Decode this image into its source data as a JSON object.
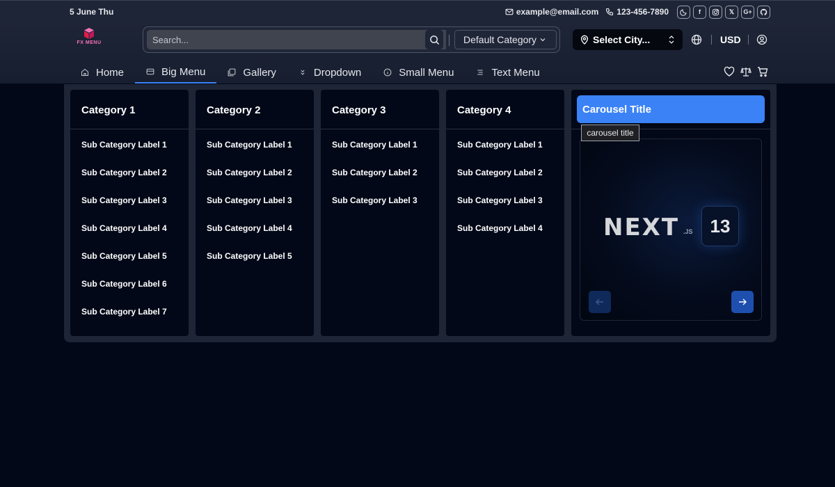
{
  "topbar": {
    "date": "5 June Thu",
    "email": "example@email.com",
    "phone": "123-456-7890",
    "social": [
      {
        "icon": "moon-icon",
        "label": ""
      },
      {
        "icon": "facebook-icon",
        "label": "f"
      },
      {
        "icon": "instagram-icon",
        "label": ""
      },
      {
        "icon": "x-icon",
        "label": "𝕏"
      },
      {
        "icon": "google-plus-icon",
        "label": "G+"
      },
      {
        "icon": "github-icon",
        "label": ""
      }
    ]
  },
  "header": {
    "logo_text": "FX MENU",
    "search_placeholder": "Search...",
    "category_select": "Default Category",
    "city_select": "Select City...",
    "currency": "USD"
  },
  "nav": {
    "items": [
      {
        "label": "Home",
        "icon": "home-icon"
      },
      {
        "label": "Big Menu",
        "icon": "menu-card-icon"
      },
      {
        "label": "Gallery",
        "icon": "gallery-icon"
      },
      {
        "label": "Dropdown",
        "icon": "chevrons-icon"
      },
      {
        "label": "Small Menu",
        "icon": "info-icon"
      },
      {
        "label": "Text Menu",
        "icon": "text-lines-icon"
      }
    ],
    "active_index": 1
  },
  "mega_menu": {
    "columns": [
      {
        "title": "Category 1",
        "items": [
          "Sub Category Label 1",
          "Sub Category Label 2",
          "Sub Category Label 3",
          "Sub Category Label 4",
          "Sub Category Label 5",
          "Sub Category Label 6",
          "Sub Category Label 7"
        ]
      },
      {
        "title": "Category 2",
        "items": [
          "Sub Category Label 1",
          "Sub Category Label 2",
          "Sub Category Label 3",
          "Sub Category Label 4",
          "Sub Category Label 5"
        ]
      },
      {
        "title": "Category 3",
        "items": [
          "Sub Category Label 1",
          "Sub Category Label 2",
          "Sub Category Label 3"
        ]
      },
      {
        "title": "Category 4",
        "items": [
          "Sub Category Label 1",
          "Sub Category Label 2",
          "Sub Category Label 3",
          "Sub Category Label 4"
        ]
      }
    ],
    "carousel": {
      "title": "Carousel Title",
      "tooltip": "carousel title",
      "slide_logo": "NEXT",
      "slide_logo_suffix": ".JS",
      "slide_version": "13"
    }
  },
  "colors": {
    "accent": "#3b82f6",
    "background": "#020817",
    "header": "#1e2537"
  }
}
